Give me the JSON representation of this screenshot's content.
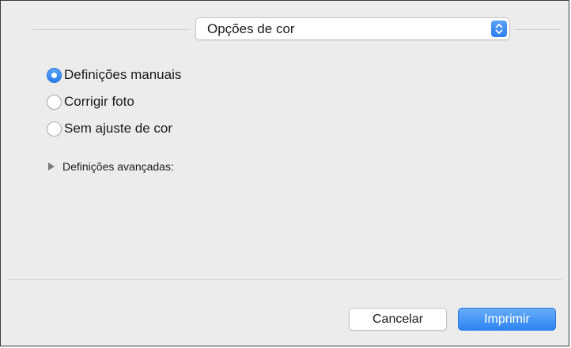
{
  "dropdown": {
    "selected": "Opções de cor",
    "icon": "up-down-chevron-icon",
    "accent": "#2d7ff0"
  },
  "color_mode": {
    "options": [
      {
        "label": "Definições manuais",
        "checked": true
      },
      {
        "label": "Corrigir foto",
        "checked": false
      },
      {
        "label": "Sem ajuste de cor",
        "checked": false
      }
    ]
  },
  "advanced": {
    "label": "Definições avançadas:",
    "expanded": false,
    "icon": "disclosure-triangle-icon"
  },
  "buttons": {
    "cancel": "Cancelar",
    "print": "Imprimir"
  }
}
